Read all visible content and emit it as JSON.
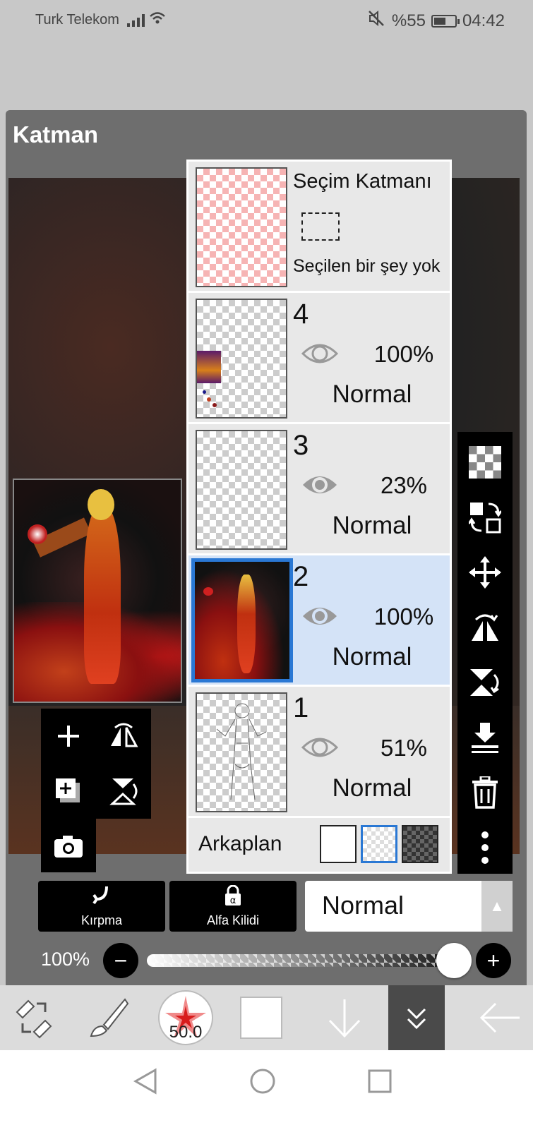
{
  "status": {
    "carrier": "Turk Telekom",
    "battery": "%55",
    "time": "04:42"
  },
  "panel": {
    "title": "Katman"
  },
  "layers": {
    "selection": {
      "name": "Seçim Katmanı",
      "empty_text": "Seçilen bir şey yok"
    },
    "items": [
      {
        "number": "4",
        "opacity": "100%",
        "mode": "Normal",
        "visible": true
      },
      {
        "number": "3",
        "opacity": "23%",
        "mode": "Normal",
        "visible": true
      },
      {
        "number": "2",
        "opacity": "100%",
        "mode": "Normal",
        "visible": true,
        "selected": true
      },
      {
        "number": "1",
        "opacity": "51%",
        "mode": "Normal",
        "visible": true
      }
    ],
    "background": {
      "label": "Arkaplan"
    }
  },
  "controls": {
    "clip_label": "Kırpma",
    "alpha_lock_label": "Alfa Kilidi",
    "blend_mode": "Normal",
    "opacity_label": "100%",
    "opacity_value": 100
  },
  "toolbar": {
    "brush_size": "50.0"
  },
  "colors": {
    "selected_layer": "#d4e3f7",
    "accent": "#2a78d4",
    "panel": "#6e6e6e"
  }
}
